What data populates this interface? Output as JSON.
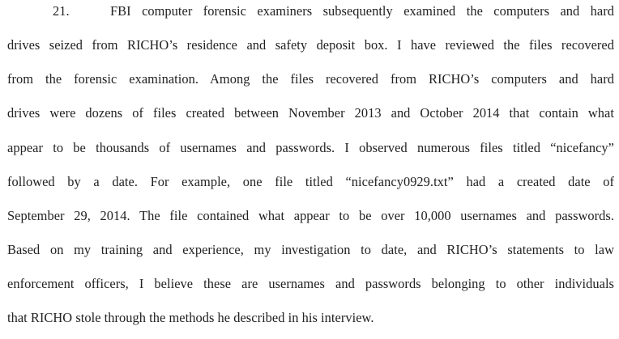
{
  "paragraph": {
    "number": "21.",
    "lines": [
      "FBI computer forensic examiners subsequently examined the computers and hard",
      "drives seized from RICHO’s residence and safety deposit box.  I have reviewed the files recovered",
      "from the forensic examination.  Among the files recovered from RICHO’s computers and hard",
      "drives were dozens of files created between November 2013 and October 2014 that contain what",
      "appear to be thousands of usernames and passwords.  I observed numerous files titled “nicefancy”",
      "followed by a date.  For example, one file titled “nicefancy0929.txt” had a created date of",
      "September 29, 2014.  The file contained what appear to be over 10,000 usernames and passwords.",
      "Based on my training and experience, my investigation to date, and RICHO’s statements to law",
      "enforcement officers, I believe these are usernames and passwords belonging to other individuals",
      "that RICHO stole through the methods he described in his interview."
    ]
  }
}
